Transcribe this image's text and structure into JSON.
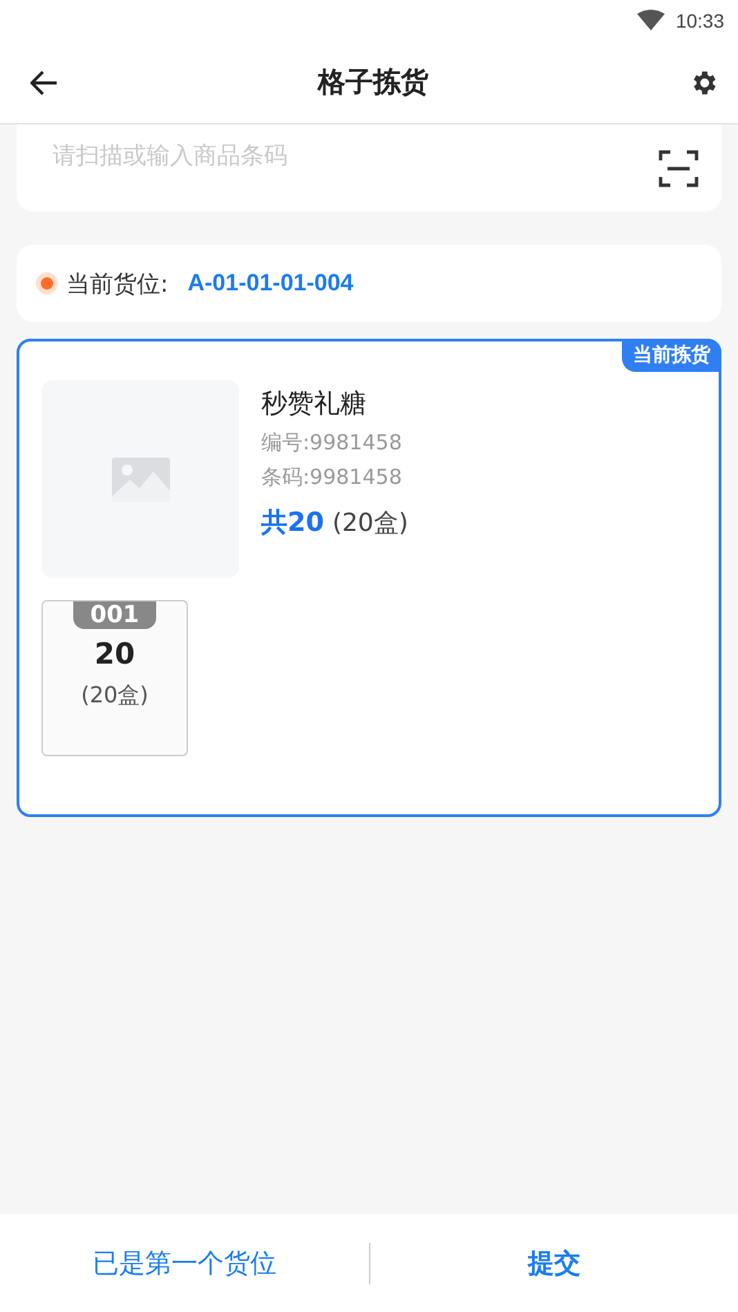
{
  "status_bar": {
    "time": "10:33"
  },
  "header": {
    "title": "格子拣货"
  },
  "search": {
    "placeholder": "请扫描或输入商品条码"
  },
  "location": {
    "label": "当前货位:",
    "value": "A-01-01-01-004"
  },
  "item": {
    "badge": "当前拣货",
    "selected": true,
    "name": "秒赞礼糖",
    "code": "编号:9981458",
    "barcode": "条码:9981458",
    "total": "共20",
    "total_unit": "(20盒)",
    "slots": [
      {
        "number": "001",
        "qty": "20",
        "unit": "(20盒)"
      }
    ]
  },
  "footer": {
    "prev": "已是第一个货位",
    "submit": "提交"
  }
}
